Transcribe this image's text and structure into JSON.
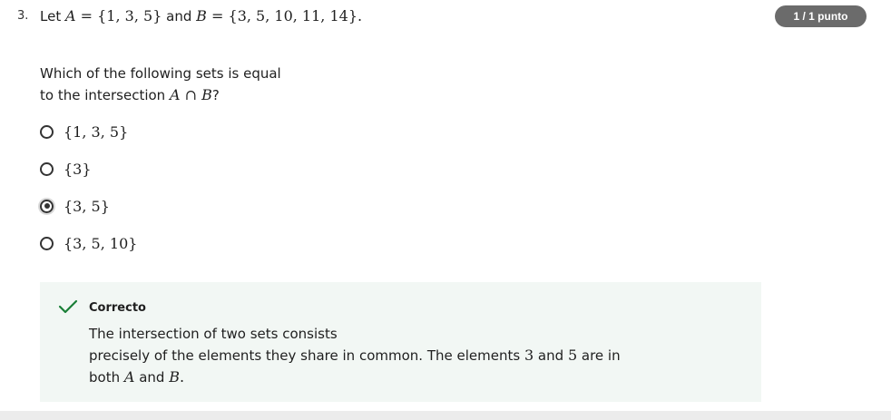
{
  "question": {
    "number": "3.",
    "prompt_prefix": "Let",
    "set_a_name": "A",
    "set_a_def": " = {1, 3, 5}",
    "and_word": "and",
    "set_b_name": "B",
    "set_b_def": " = {3, 5, 10, 11, 14}.",
    "text_line1": "Which of the following sets is equal",
    "text_line2": "to the intersection",
    "intersection_expr": "A ∩ B",
    "text_end": "?"
  },
  "score": {
    "label": "1 / 1 punto"
  },
  "options": [
    {
      "label": "{1, 3, 5}",
      "selected": false
    },
    {
      "label": "{3}",
      "selected": false
    },
    {
      "label": "{3, 5}",
      "selected": true
    },
    {
      "label": "{3, 5, 10}",
      "selected": false
    }
  ],
  "feedback": {
    "title": "Correcto",
    "line1": "The intersection of two sets consists",
    "line2_pre": "precisely of the elements they share in common. The elements",
    "num3": "3",
    "and1": "and",
    "num5": "5",
    "line2_post": "are in",
    "line3_pre": "both",
    "var_a": "A",
    "and2": "and",
    "var_b": "B",
    "period": ".",
    "status_color": "#1a7f37"
  }
}
